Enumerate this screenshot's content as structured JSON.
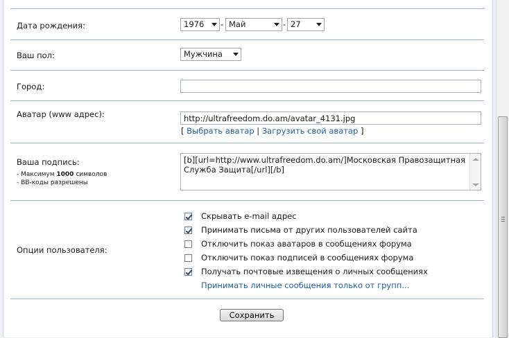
{
  "birthdate": {
    "label": "Дата рождения:",
    "year": "1976",
    "month": "Май",
    "day": "27",
    "separator": "-"
  },
  "gender": {
    "label": "Ваш пол:",
    "value": "Мужчина"
  },
  "city": {
    "label": "Город:",
    "value": ""
  },
  "avatar": {
    "label": "Аватар (www адрес):",
    "value": "http://ultrafreedom.do.am/avatar_4131.jpg",
    "bracket_open": "[",
    "choose_link": "Выбрать аватар",
    "divider": "|",
    "upload_link": "Загрузить свой аватар",
    "bracket_close": "]"
  },
  "signature": {
    "label": "Ваша подпись:",
    "note_prefix": "- Максимум ",
    "note_max": "1000",
    "note_suffix": " символов",
    "note_bbcode": "- BB-коды разрешены",
    "value": "[b][url=http://www.ultrafreedom.do.am/]Московская Правозащитная Служба Защита[/url][/b]"
  },
  "options": {
    "label": "Опции пользователя:",
    "items": [
      {
        "label": "Скрывать e-mail адрес",
        "checked": true
      },
      {
        "label": "Принимать письма от других пользователей сайта",
        "checked": true
      },
      {
        "label": "Отключить показ аватаров в сообщениях форума",
        "checked": false
      },
      {
        "label": "Отключить показ подписей в сообщениях форума",
        "checked": false
      },
      {
        "label": "Получать почтовые извещения о личных сообщениях",
        "checked": true
      }
    ],
    "groups_link": "Принимать личные сообщения только от групп..."
  },
  "save_label": "Сохранить",
  "colors": {
    "link": "#1f5fa8",
    "divider": "#9db7d1",
    "page_background": "#eaf1f8"
  }
}
